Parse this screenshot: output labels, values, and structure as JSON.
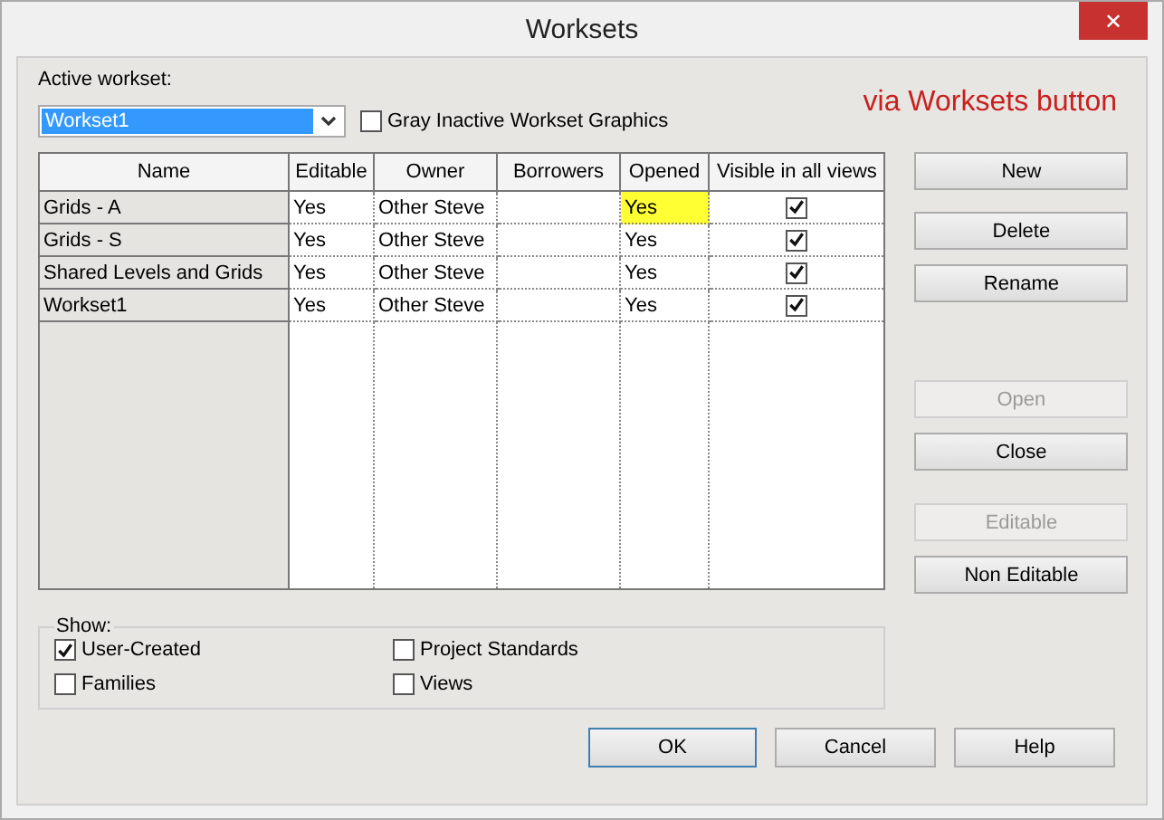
{
  "window": {
    "title": "Worksets",
    "close": "✕"
  },
  "active_workset": {
    "label": "Active workset:",
    "value": "Workset1"
  },
  "gray_inactive": {
    "label": "Gray Inactive Workset Graphics",
    "checked": false
  },
  "annotation": "via Worksets button",
  "table": {
    "columns": [
      "Name",
      "Editable",
      "Owner",
      "Borrowers",
      "Opened",
      "Visible in all views"
    ],
    "rows": [
      {
        "name": "Grids - A",
        "editable": "Yes",
        "owner": "Other Steve",
        "opened": "Yes",
        "opened_highlighted": true,
        "visible": true
      },
      {
        "name": "Grids - S",
        "editable": "Yes",
        "owner": "Other Steve",
        "opened": "Yes",
        "opened_highlighted": false,
        "visible": true
      },
      {
        "name": "Shared Levels and Grids",
        "editable": "Yes",
        "owner": "Other Steve",
        "opened": "Yes",
        "opened_highlighted": false,
        "visible": true
      },
      {
        "name": "Workset1",
        "editable": "Yes",
        "owner": "Other Steve",
        "opened": "Yes",
        "opened_highlighted": false,
        "visible": true
      }
    ]
  },
  "side_buttons": [
    {
      "label": "New",
      "disabled": false
    },
    {
      "label": "Delete",
      "disabled": false
    },
    {
      "label": "Rename",
      "disabled": false
    },
    {
      "label": "Open",
      "disabled": true
    },
    {
      "label": "Close",
      "disabled": false
    },
    {
      "label": "Editable",
      "disabled": true
    },
    {
      "label": "Non Editable",
      "disabled": false
    }
  ],
  "show": {
    "label": "Show:",
    "options": [
      {
        "label": "User-Created",
        "checked": true
      },
      {
        "label": "Project Standards",
        "checked": false
      },
      {
        "label": "Families",
        "checked": false
      },
      {
        "label": "Views",
        "checked": false
      }
    ]
  },
  "footer_buttons": [
    {
      "label": "OK",
      "default": true
    },
    {
      "label": "Cancel",
      "default": false
    },
    {
      "label": "Help",
      "default": false
    }
  ]
}
